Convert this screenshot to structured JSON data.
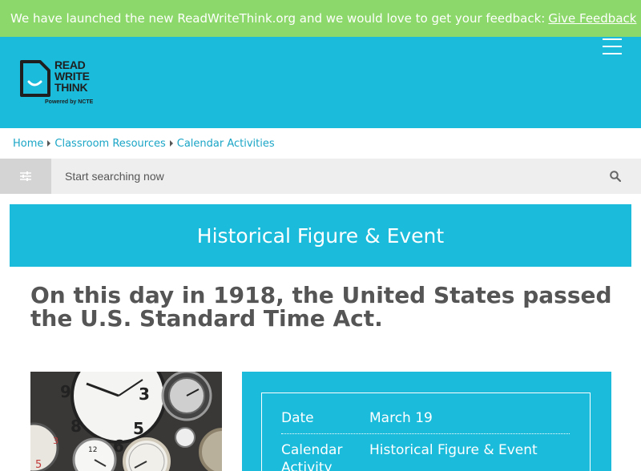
{
  "banner": {
    "text": "We have launched the new ReadWriteThink.org and we would love to get your feedback:",
    "link_label": "Give Feedback"
  },
  "logo": {
    "line1": "READ",
    "line2": "WRITE",
    "line3": "THINK",
    "powered_by": "Powered by NCTE"
  },
  "breadcrumb": {
    "items": [
      "Home",
      "Classroom Resources",
      "Calendar Activities"
    ]
  },
  "search": {
    "placeholder": "Start searching now"
  },
  "category": {
    "title": "Historical Figure & Event"
  },
  "headline": "On this day in 1918, the United States passed the U.S. Standard Time Act.",
  "info": {
    "rows": [
      {
        "label": "Date",
        "value": "March 19"
      },
      {
        "label": "Calendar Activity",
        "value": "Historical Figure & Event"
      }
    ]
  },
  "colors": {
    "banner": "#8dd86a",
    "brand": "#1bbbdb",
    "headline": "#555555"
  },
  "icons": {
    "menu": "hamburger-menu-icon",
    "filter": "sliders-icon",
    "search": "magnifier-icon"
  }
}
